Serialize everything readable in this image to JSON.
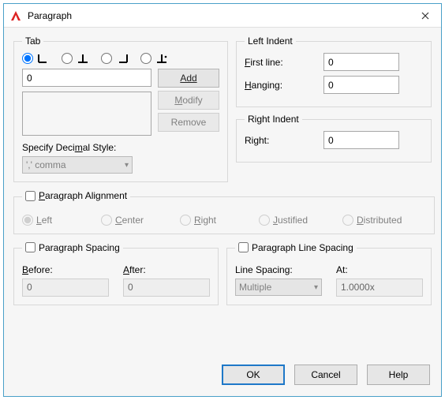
{
  "titlebar": {
    "title": "Paragraph"
  },
  "tab": {
    "legend": "Tab",
    "value": "0",
    "buttons": {
      "add": "Add",
      "modify": "Modify",
      "remove": "Remove"
    },
    "decimal_label_pre": "Specify Deci",
    "decimal_label_u": "m",
    "decimal_label_post": "al Style:",
    "decimal_combo": "',' comma",
    "icons": [
      "tab-left",
      "tab-center",
      "tab-right",
      "tab-decimal"
    ],
    "selected_icon": 0
  },
  "left_indent": {
    "legend": "Left Indent",
    "first_u": "F",
    "first_rest": "irst line:",
    "hanging_u": "H",
    "hanging_rest": "anging:",
    "first_value": "0",
    "hanging_value": "0"
  },
  "right_indent": {
    "legend": "Right Indent",
    "label": "Right:",
    "value": "0"
  },
  "alignment": {
    "legend_pre": "",
    "legend_u": "P",
    "legend_post": "aragraph Alignment",
    "items": [
      {
        "u": "L",
        "rest": "eft"
      },
      {
        "u": "C",
        "rest": "enter"
      },
      {
        "u": "R",
        "rest": "ight"
      },
      {
        "u": "J",
        "rest": "ustified"
      },
      {
        "u": "D",
        "rest": "istributed"
      }
    ],
    "enabled": false,
    "selected": 0
  },
  "spacing": {
    "legend": "Paragraph Spacing",
    "before_u": "B",
    "before_rest": "efore:",
    "after_u": "A",
    "after_rest": "fter:",
    "before_value": "0",
    "after_value": "0",
    "enabled": false
  },
  "line_spacing": {
    "legend": "Paragraph Line Spacing",
    "label1": "Line Spacing:",
    "label2": "At:",
    "combo": "Multiple",
    "at_value": "1.0000x",
    "enabled": false
  },
  "footer": {
    "ok": "OK",
    "cancel": "Cancel",
    "help": "Help"
  }
}
